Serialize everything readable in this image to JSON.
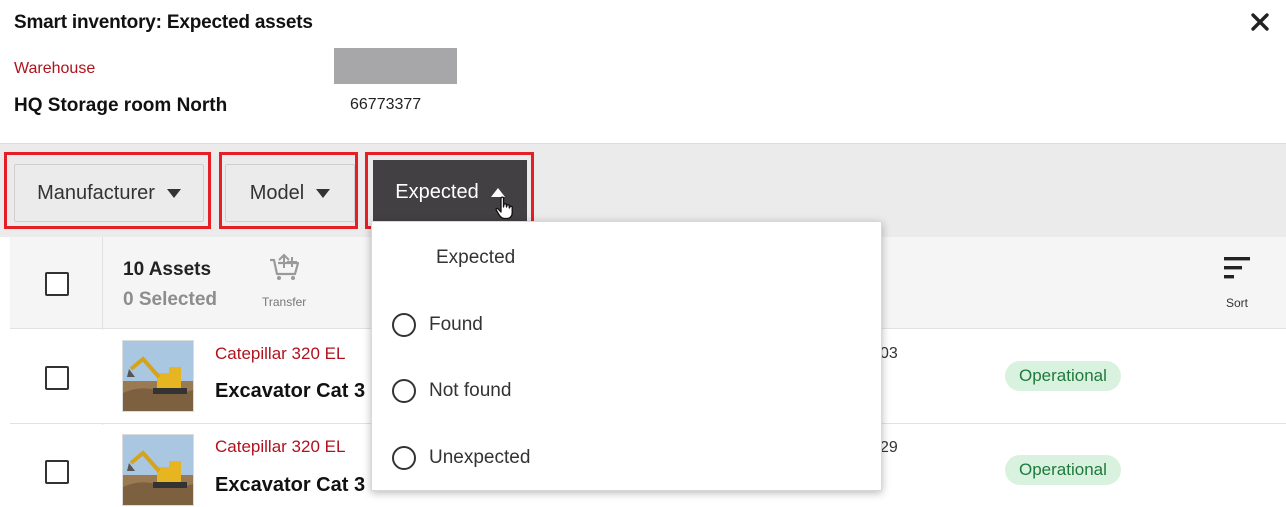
{
  "modal": {
    "title": "Smart inventory: Expected assets",
    "close_icon": "close-icon"
  },
  "location": {
    "label": "Warehouse",
    "name": "HQ Storage room North",
    "code": "66773377"
  },
  "filters": {
    "manufacturer": "Manufacturer",
    "model": "Model",
    "expected": "Expected"
  },
  "list_header": {
    "assets_count": "10 Assets",
    "selected_count": "0 Selected",
    "transfer_label": "Transfer",
    "sort_label": "Sort"
  },
  "rows": [
    {
      "model": "Catepillar 320 EL",
      "name": "Excavator Cat 3",
      "id_partial": "03",
      "status": "Operational"
    },
    {
      "model": "Catepillar 320 EL",
      "name": "Excavator Cat 3",
      "id_partial": "29",
      "status": "Operational"
    }
  ],
  "dropdown": {
    "header": "Expected",
    "options": [
      "Found",
      "Not found",
      "Unexpected"
    ]
  },
  "colors": {
    "accent_red": "#b0121d",
    "highlight_red": "#e41f26",
    "active_button": "#434043",
    "status_green_bg": "#d9f2e0",
    "status_green_text": "#1e7a3b"
  }
}
